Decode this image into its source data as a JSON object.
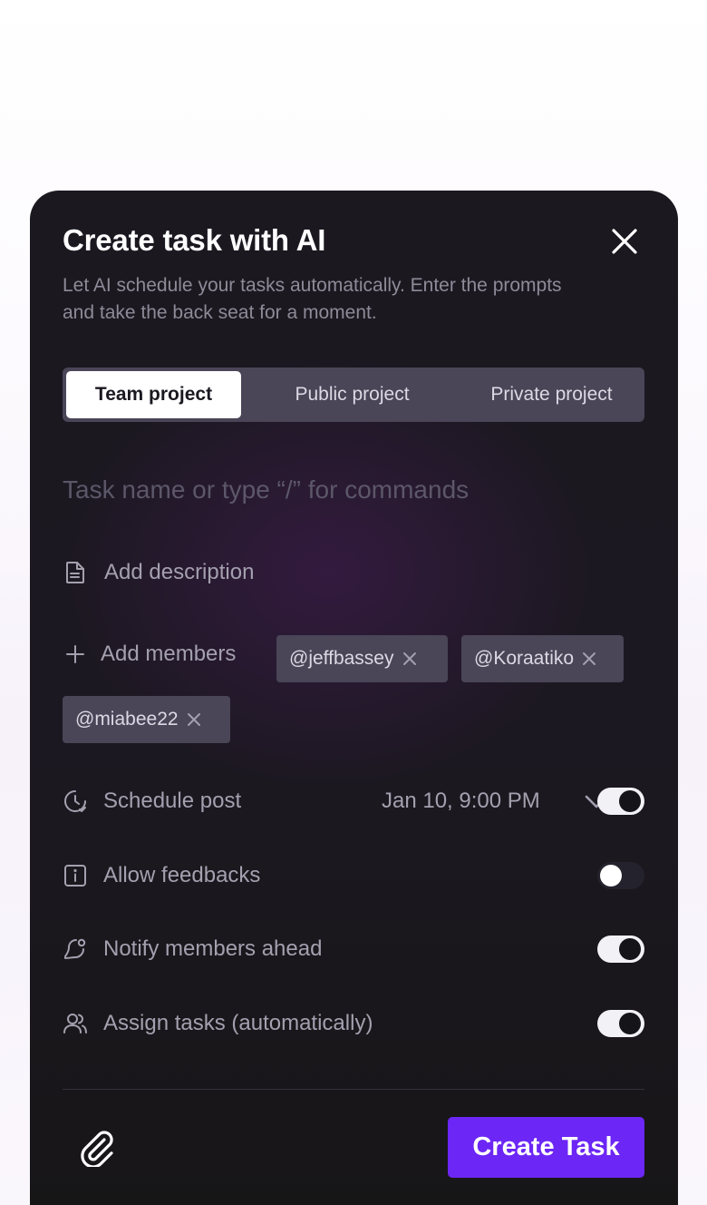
{
  "modal": {
    "title": "Create task with AI",
    "subtitle": "Let AI schedule your tasks automatically. Enter the prompts and take the back seat for a moment."
  },
  "tabs": [
    {
      "label": "Team project",
      "selected": true
    },
    {
      "label": "Public project",
      "selected": false
    },
    {
      "label": "Private project",
      "selected": false
    }
  ],
  "task_input": {
    "placeholder": "Task name or type “/” for commands",
    "value": ""
  },
  "description": {
    "label": "Add description"
  },
  "members": {
    "label": "Add members",
    "chips": [
      "@jeffbassey",
      "@Koraatiko",
      "@miabee22"
    ]
  },
  "options": [
    {
      "label": "Schedule post",
      "icon": "clock-icon",
      "value": "Jan 10, 9:00 PM",
      "enabled": true
    },
    {
      "label": "Allow feedbacks",
      "icon": "info-icon",
      "enabled": false
    },
    {
      "label": "Notify members ahead",
      "icon": "bell-icon",
      "enabled": true
    },
    {
      "label": "Assign tasks (automatically)",
      "icon": "users-icon",
      "enabled": true
    }
  ],
  "footer": {
    "create_label": "Create Task"
  },
  "colors": {
    "accent": "#6c26f5",
    "modal_bg": "#1b1820",
    "chip_bg": "#4a4557",
    "muted_text": "#a4a0af"
  }
}
